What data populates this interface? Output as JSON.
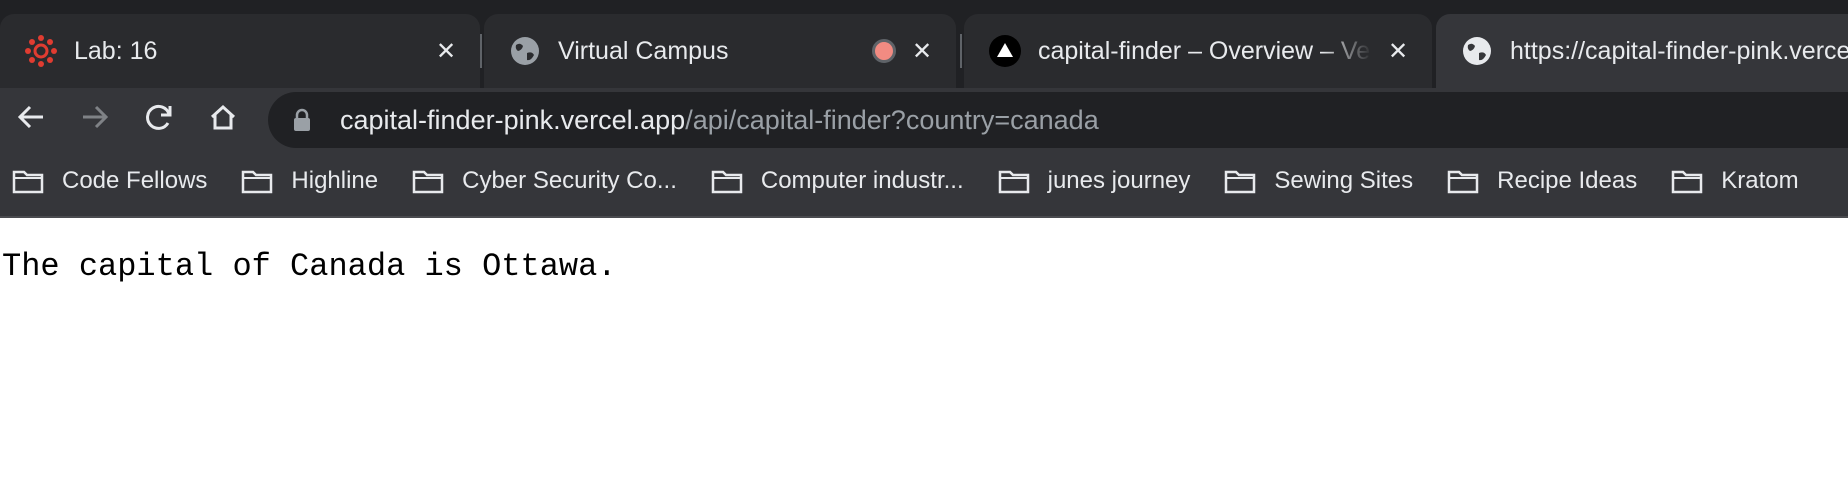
{
  "tabs": [
    {
      "title": "Lab: 16",
      "favicon": "canvas-logo-icon",
      "active": false
    },
    {
      "title": "Virtual Campus",
      "favicon": "globe-icon",
      "active": false,
      "recording": true
    },
    {
      "title": "capital-finder – Overview – Vercel",
      "favicon": "vercel-triangle-icon",
      "active": false
    },
    {
      "title": "https://capital-finder-pink.vercel.app/api/capital-finder?country=canada",
      "favicon": "globe-icon",
      "active": true
    }
  ],
  "omnibox": {
    "host": "capital-finder-pink.vercel.app",
    "path": "/api/capital-finder?country=canada"
  },
  "bookmarks": [
    {
      "label": "Code Fellows"
    },
    {
      "label": "Highline"
    },
    {
      "label": "Cyber Security Co..."
    },
    {
      "label": "Computer industr..."
    },
    {
      "label": "junes journey"
    },
    {
      "label": "Sewing Sites"
    },
    {
      "label": "Recipe Ideas"
    },
    {
      "label": "Kratom"
    }
  ],
  "page": {
    "text": "The capital of Canada is Ottawa."
  },
  "colors": {
    "chrome_bg": "#202124",
    "toolbar_bg": "#35363a",
    "canvas_red": "#e03c31",
    "record_dot": "#f28b82"
  }
}
